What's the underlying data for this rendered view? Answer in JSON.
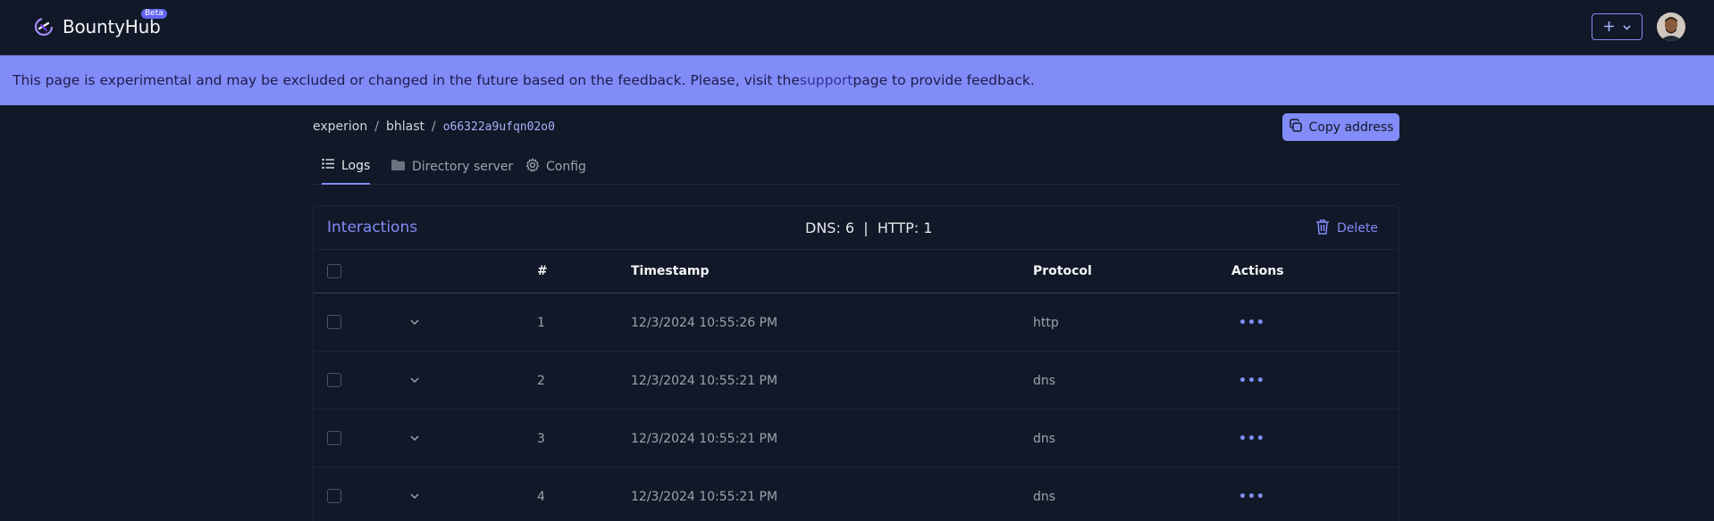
{
  "app": {
    "name": "BountyHub",
    "badge": "Beta",
    "logo_icon": "bountyhub-logo-icon"
  },
  "header": {
    "add_icon": "plus-icon",
    "dropdown_icon": "chevron-down-icon",
    "avatar_icon": "user-avatar"
  },
  "banner": {
    "text_before": "This page is experimental and may be excluded or changed in the future based on the feedback. Please, visit the ",
    "link_text": "support",
    "text_after": " page to provide feedback."
  },
  "breadcrumb": {
    "items": [
      "experion",
      "bhlast"
    ],
    "separator": "/",
    "current": "o66322a9ufqn02o0"
  },
  "copy_button": {
    "label": "Copy address",
    "icon": "copy-icon"
  },
  "tabs": [
    {
      "label": "Logs",
      "icon": "list-icon",
      "active": true
    },
    {
      "label": "Directory server",
      "icon": "folder-icon",
      "active": false
    },
    {
      "label": "Config",
      "icon": "gear-icon",
      "active": false
    }
  ],
  "interactions": {
    "title": "Interactions",
    "stats": "DNS: 6  |  HTTP: 1",
    "delete_label": "Delete",
    "delete_icon": "trash-icon",
    "columns": {
      "number": "#",
      "timestamp": "Timestamp",
      "protocol": "Protocol",
      "actions": "Actions"
    },
    "rows": [
      {
        "number": "1",
        "timestamp": "12/3/2024 10:55:26 PM",
        "protocol": "http"
      },
      {
        "number": "2",
        "timestamp": "12/3/2024 10:55:21 PM",
        "protocol": "dns"
      },
      {
        "number": "3",
        "timestamp": "12/3/2024 10:55:21 PM",
        "protocol": "dns"
      },
      {
        "number": "4",
        "timestamp": "12/3/2024 10:55:21 PM",
        "protocol": "dns"
      }
    ],
    "actions_glyph": "•••"
  },
  "colors": {
    "background": "#111827",
    "accent": "#818cf8",
    "banner": "#818cf8"
  }
}
